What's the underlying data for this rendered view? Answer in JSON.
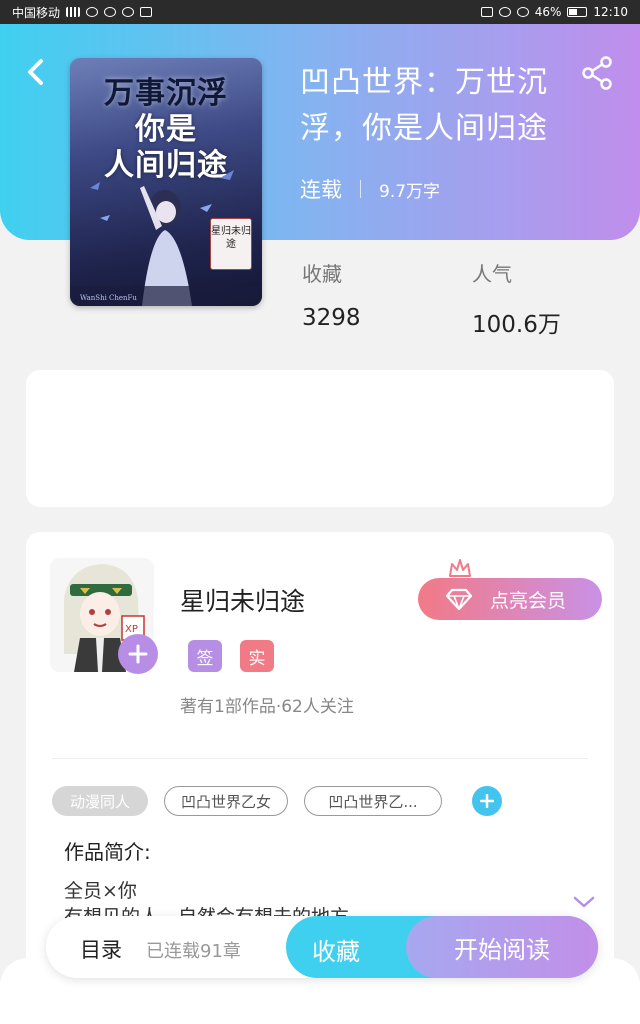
{
  "status_bar": {
    "carrier": "中国移动",
    "battery_text": "46%",
    "time": "12:10",
    "icons": [
      "signal-icon",
      "wifi-icon",
      "chat-icon",
      "qq-icon",
      "app-icon",
      "hd-icon",
      "vibrate-icon",
      "alarm-icon",
      "battery-icon"
    ]
  },
  "header": {
    "back_icon": "chevron-left-icon",
    "share_icon": "share-icon"
  },
  "book": {
    "title": "凹凸世界：万世沉浮，你是人间归途",
    "status": "连载",
    "word_count": "9.7万字",
    "cover": {
      "title_lines": [
        "万事沉浮",
        "你是",
        "人间归途"
      ],
      "stamp": "星归未归途",
      "signature": "WanShi ChenFu"
    },
    "stats": {
      "favorites_label": "收藏",
      "favorites_value": "3298",
      "popularity_label": "人气",
      "popularity_value": "100.6万"
    }
  },
  "author": {
    "name": "星归未归途",
    "badge_sign": "签",
    "badge_real": "实",
    "summary": "著有1部作品·62人关注",
    "follow_icon": "plus-icon",
    "vip_button": "点亮会员",
    "vip_icon": "diamond-icon",
    "crown_icon": "crown-icon"
  },
  "tags": {
    "category": "动漫同人",
    "items": [
      "凹凸世界乙女",
      "凹凸世界乙..."
    ],
    "add_icon": "plus-icon"
  },
  "intro": {
    "title": "作品简介:",
    "line1": "全员×你",
    "line2": "有想见的人，自然会有想去的地方",
    "expand_icon": "chevron-down-icon"
  },
  "bottom_bar": {
    "toc_label": "目录",
    "toc_count": "已连载91章",
    "favorite_button": "收藏",
    "read_button": "开始阅读"
  },
  "colors": {
    "gradient_start": "#3fd0f0",
    "gradient_end": "#c08eec",
    "accent_pink": "#f07b86",
    "accent_purple": "#b68ee4"
  }
}
